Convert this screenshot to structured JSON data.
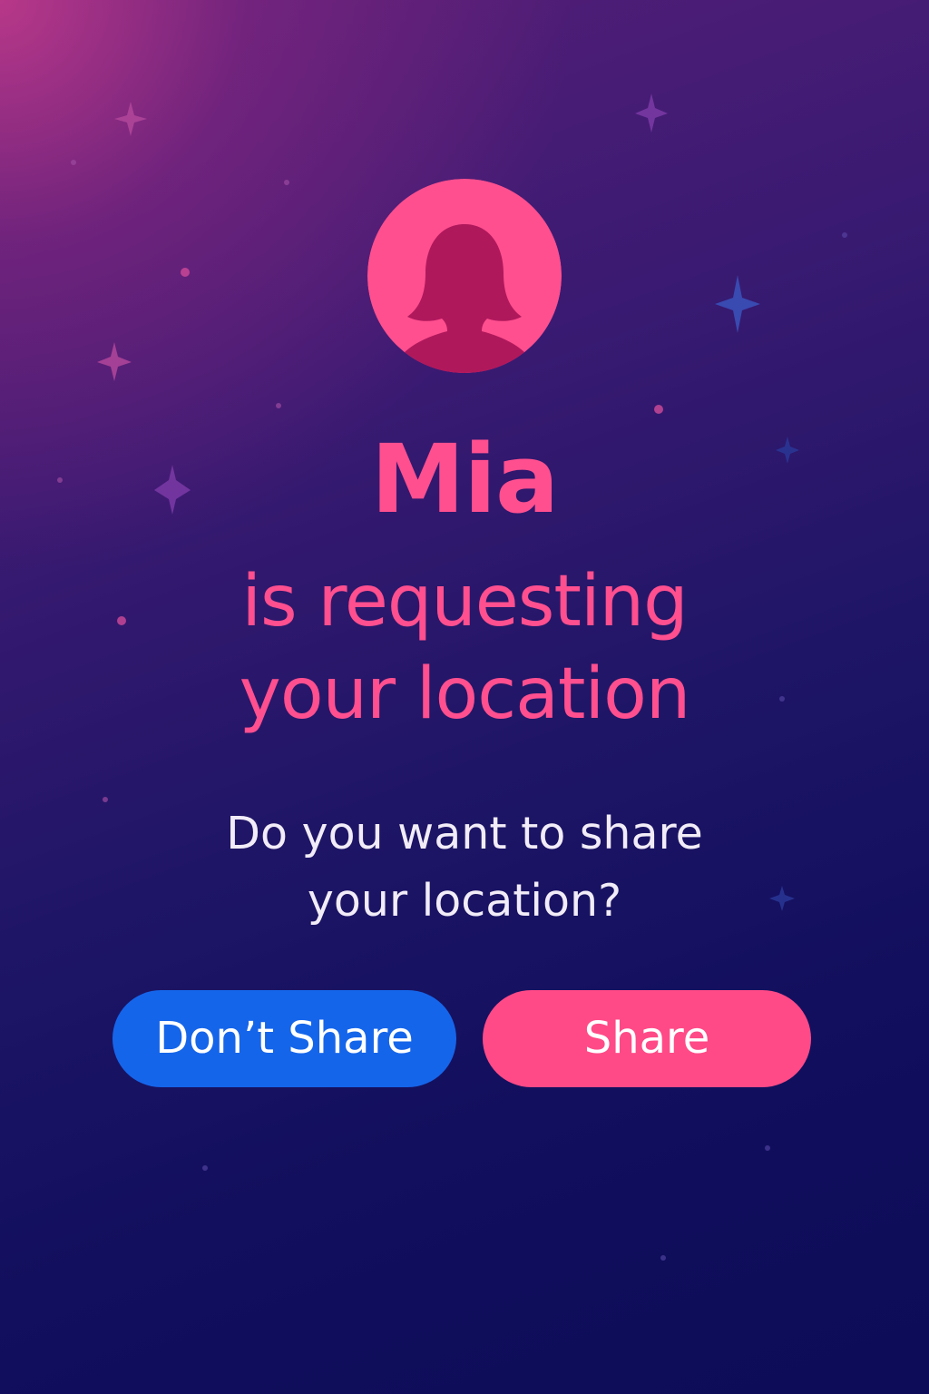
{
  "requester": {
    "name": "Mia",
    "message_line1": "is requesting",
    "message_line2": "your location"
  },
  "prompt": {
    "line1": "Do you want to share",
    "line2": "your location?"
  },
  "actions": {
    "deny_label": "Don’t Share",
    "share_label": "Share"
  },
  "icons": {
    "avatar": "person-silhouette-icon",
    "decoration": "sparkle-icon"
  },
  "colors": {
    "accent_pink": "#ff4f8f",
    "deny_blue": "#1565ea",
    "share_pink": "#ff4a87",
    "avatar_bg": "#ff4f8f",
    "avatar_silhouette": "#b0185c",
    "background_dark": "#0c0c58",
    "background_magenta": "#c83c8c"
  }
}
